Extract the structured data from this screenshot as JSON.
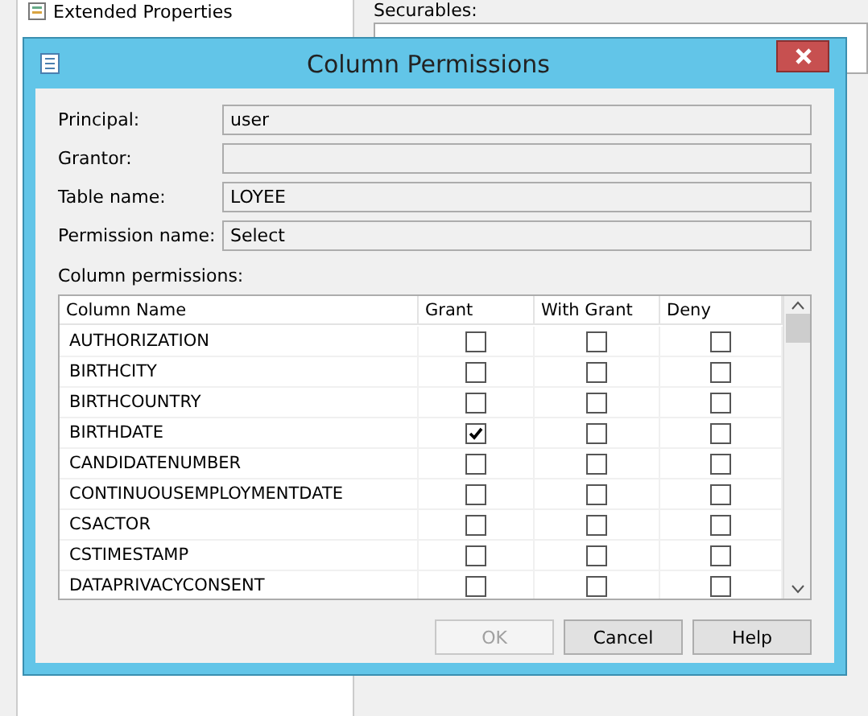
{
  "background": {
    "sidebar_item": "Extended Properties",
    "securables_label": "Securables:"
  },
  "dialog": {
    "title": "Column Permissions",
    "fields": [
      {
        "label": "Principal:",
        "value": "user"
      },
      {
        "label": "Grantor:"
      },
      {
        "label": "Table name:",
        "value": "LOYEE"
      },
      {
        "label": "Permission name:",
        "value": "Select"
      }
    ],
    "grid_label": "Column permissions:",
    "columns": [
      "Column Name",
      "Grant",
      "With Grant",
      "Deny"
    ],
    "rows": [
      {
        "name": "AUTHORIZATION",
        "grant": false,
        "with_grant": false,
        "deny": false
      },
      {
        "name": "BIRTHCITY",
        "grant": false,
        "with_grant": false,
        "deny": false
      },
      {
        "name": "BIRTHCOUNTRY",
        "grant": false,
        "with_grant": false,
        "deny": false
      },
      {
        "name": "BIRTHDATE",
        "grant": true,
        "with_grant": false,
        "deny": false
      },
      {
        "name": "CANDIDATENUMBER",
        "grant": false,
        "with_grant": false,
        "deny": false
      },
      {
        "name": "CONTINUOUSEMPLOYMENTDATE",
        "grant": false,
        "with_grant": false,
        "deny": false
      },
      {
        "name": "CSACTOR",
        "grant": false,
        "with_grant": false,
        "deny": false
      },
      {
        "name": "CSTIMESTAMP",
        "grant": false,
        "with_grant": false,
        "deny": false
      },
      {
        "name": "DATAPRIVACYCONSENT",
        "grant": false,
        "with_grant": false,
        "deny": false
      }
    ],
    "buttons": [
      {
        "label": "OK",
        "disabled": true
      },
      {
        "label": "Cancel",
        "disabled": false
      },
      {
        "label": "Help",
        "disabled": false
      }
    ]
  }
}
